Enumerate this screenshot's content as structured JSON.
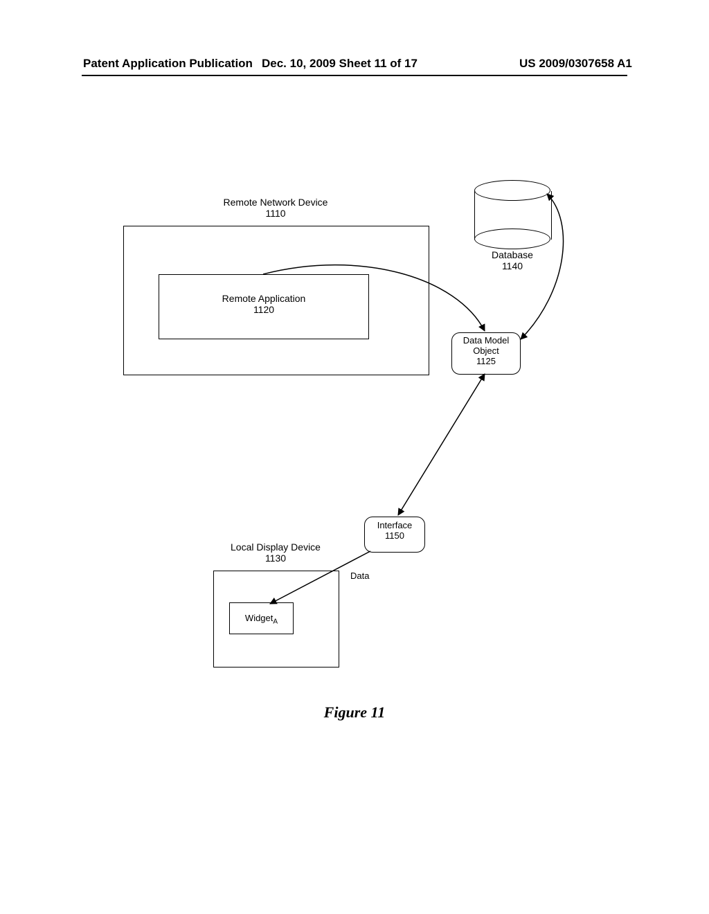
{
  "header": {
    "left": "Patent Application Publication",
    "mid": "Dec. 10, 2009  Sheet 11 of 17",
    "right": "US 2009/0307658 A1"
  },
  "remote_device": {
    "title": "Remote Network Device",
    "ref": "1110"
  },
  "remote_app": {
    "title": "Remote Application",
    "ref": "1120"
  },
  "database": {
    "title": "Database",
    "ref": "1140"
  },
  "data_model": {
    "title": "Data Model Object",
    "ref": "1125"
  },
  "local_device": {
    "title": "Local Display Device",
    "ref": "1130"
  },
  "widget": {
    "label": "Widget",
    "sub": "A"
  },
  "interface": {
    "title": "Interface",
    "ref": "1150"
  },
  "data_label": "Data",
  "figure_caption": "Figure 11"
}
